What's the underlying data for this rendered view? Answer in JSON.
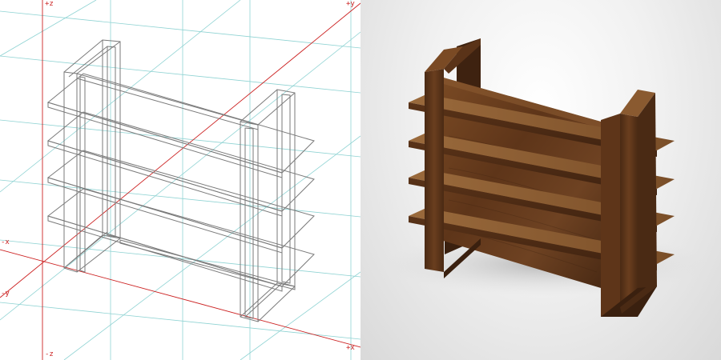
{
  "viewport_wireframe": {
    "axis_labels": {
      "z_pos": "+z",
      "y_pos": "+y",
      "x_neg": "-x",
      "y_neg": "-y",
      "z_neg": "-z",
      "x_pos": "+x"
    },
    "colors": {
      "grid": "#8fd3d3",
      "axis": "#cc2222",
      "wire": "#7a7a7a"
    }
  },
  "viewport_render": {
    "colors": {
      "wood_dark": "#4a2a14",
      "wood_mid": "#6b3f1f",
      "wood_light": "#8a5a30",
      "shadow": "#b8b8b8"
    }
  }
}
